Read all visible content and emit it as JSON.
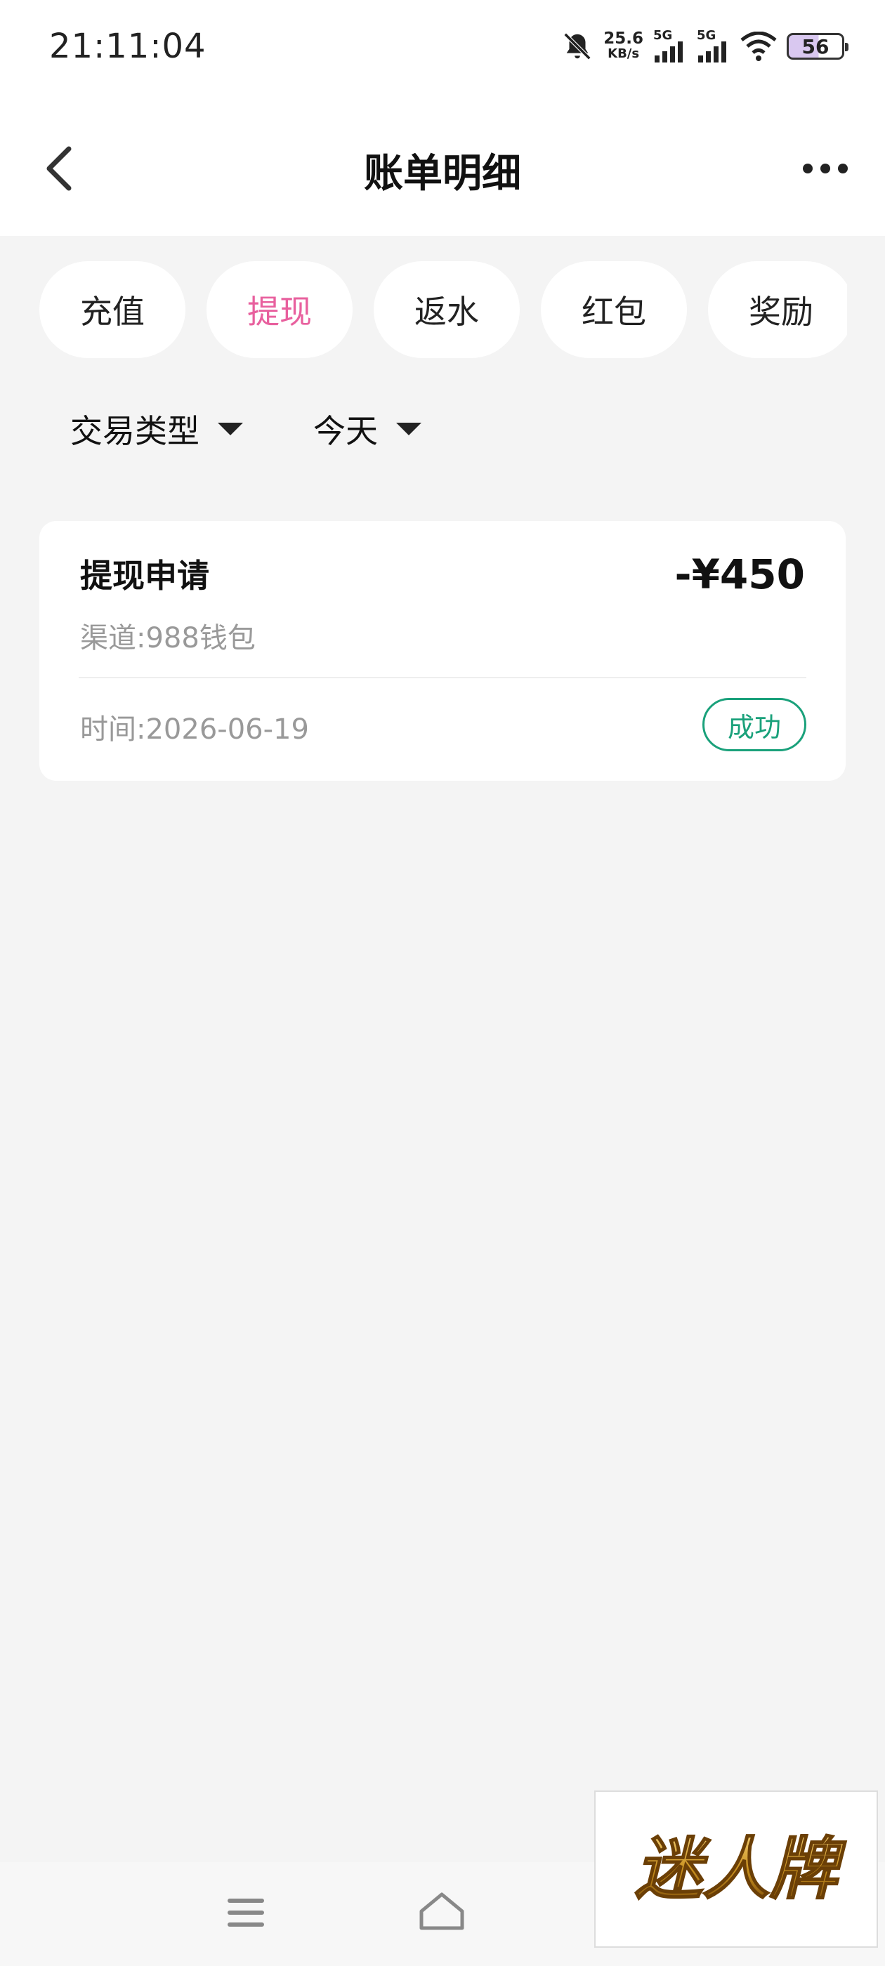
{
  "status_bar": {
    "time": "21:11:04",
    "net_speed": "25.6",
    "net_unit": "KB/s",
    "sim1": "5G",
    "sim2": "5G",
    "battery": "56"
  },
  "header": {
    "title": "账单明细"
  },
  "tabs": [
    {
      "label": "充值",
      "active": false
    },
    {
      "label": "提现",
      "active": true
    },
    {
      "label": "返水",
      "active": false
    },
    {
      "label": "红包",
      "active": false
    },
    {
      "label": "奖励",
      "active": false
    }
  ],
  "filters": {
    "type_label": "交易类型",
    "date_label": "今天"
  },
  "records": [
    {
      "title": "提现申请",
      "amount": "-¥450",
      "channel": "渠道:988钱包",
      "time": "时间:2026-06-19",
      "status": "成功"
    }
  ],
  "watermark": {
    "text": "迷人牌"
  },
  "colors": {
    "accent": "#e8609e",
    "success": "#1aa17b",
    "background": "#f4f4f4"
  }
}
